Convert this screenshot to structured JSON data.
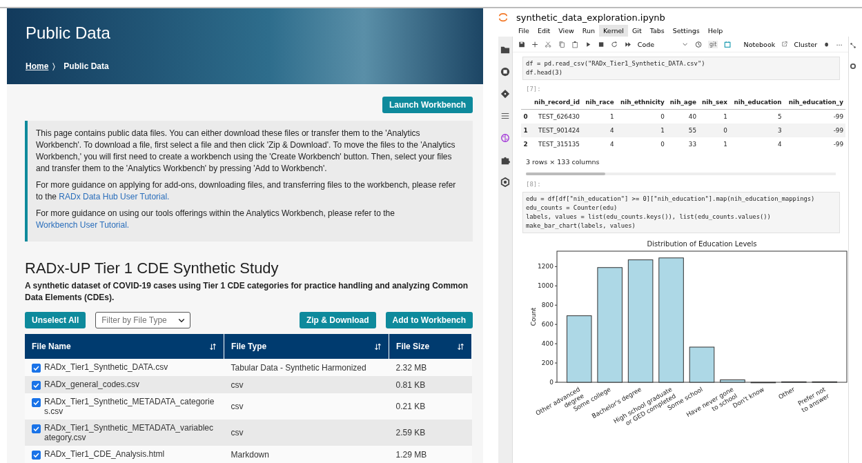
{
  "portal": {
    "title": "Public Data",
    "breadcrumb": [
      {
        "label": "Home",
        "link": true
      },
      {
        "label": "〉",
        "link": false
      },
      {
        "label": "Public Data",
        "link": false
      }
    ],
    "launch_button": "Launch Workbench",
    "info": [
      {
        "text": "This page contains public data files. You can either download these files or transfer them to the 'Analytics Workbench'. To download a file, first select a file and then click 'Zip & Download'. To move the files to the 'Analytics Workbench,' you will first need to create a workbench using the 'Create Workbench' button. Then, select your files and transfer them to the 'Analytics Workbench' by pressing 'Add to Workbench'."
      },
      {
        "text": "For more guidance on applying for add-ons, downloading files, and transferring files to the workbench, please refer to the ",
        "link": "RADx Data Hub User Tutorial."
      },
      {
        "text": "For more guidance on using our tools offerings within the Analytics Workbench, please refer to the ",
        "link": "Workbench User Tutorial."
      }
    ],
    "study_title": "RADx-UP Tier 1 CDE Synthetic Study",
    "study_description": "A synthetic dataset of COVID-19 cases using Tier 1 CDE categories for practice handling and analyzing Common Data Elements (CDEs).",
    "unselect_button": "Unselect All",
    "filter": {
      "placeholder": "Filter by File Type"
    },
    "zip_button": "Zip & Download",
    "add_button": "Add to Workbench",
    "table": {
      "columns": [
        "File Name",
        "File Type",
        "File Size"
      ],
      "rows": [
        {
          "checked": true,
          "name": "RADx_Tier1_Synthetic_DATA.csv",
          "type": "Tabular Data - Synthetic Harmonized",
          "size": "2.32 MB"
        },
        {
          "checked": true,
          "name": "RADx_general_codes.csv",
          "type": "csv",
          "size": "0.81 KB"
        },
        {
          "checked": true,
          "name": "RADx_Tier1_Synthetic_METADATA_categories.csv",
          "type": "csv",
          "size": "0.21 KB"
        },
        {
          "checked": true,
          "name": "RADx_Tier1_Synthetic_METADATA_variablecategory.csv",
          "type": "csv",
          "size": "2.59 KB"
        },
        {
          "checked": true,
          "name": "RADx_Tier1_CDE_Analysis.html",
          "type": "Markdown",
          "size": "1.29 MB"
        }
      ]
    }
  },
  "notebook": {
    "title": "synthetic_data_exploration.ipynb",
    "menu": [
      {
        "label": "File",
        "selected": false
      },
      {
        "label": "Edit",
        "selected": false
      },
      {
        "label": "View",
        "selected": false
      },
      {
        "label": "Run",
        "selected": false
      },
      {
        "label": "Kernel",
        "selected": true
      },
      {
        "label": "Git",
        "selected": false
      },
      {
        "label": "Tabs",
        "selected": false
      },
      {
        "label": "Settings",
        "selected": false
      },
      {
        "label": "Help",
        "selected": false
      }
    ],
    "cell_type": "Code",
    "git_label": "git",
    "notebook_button": "Notebook",
    "cluster_button": "Cluster",
    "more": "⋯",
    "cell1_code": [
      "df = pd.read_csv(\"RADx_Tier1_Synthetic_DATA.csv\")",
      "df.head(3)"
    ],
    "out1_prompt": "[7]:",
    "dataframe": {
      "columns": [
        "",
        "nih_record_id",
        "nih_race",
        "nih_ethnicity",
        "nih_age",
        "nih_sex",
        "nih_education",
        "nih_education_y"
      ],
      "rows": [
        [
          "0",
          "TEST_626430",
          "1",
          "0",
          "40",
          "1",
          "5",
          "-99"
        ],
        [
          "1",
          "TEST_901424",
          "4",
          "1",
          "55",
          "0",
          "3",
          "-99"
        ],
        [
          "2",
          "TEST_315135",
          "4",
          "0",
          "33",
          "1",
          "4",
          "-99"
        ]
      ],
      "summary": "3 rows × 133 columns"
    },
    "cell2_prompt": "[8]:",
    "cell2_code": [
      "edu = df[df[\"nih_education\"] >= 0][\"nih_education\"].map(nih_education_mappings)",
      "edu_counts = Counter(edu)",
      "labels, values = list(edu_counts.keys()), list(edu_counts.values())",
      "make_bar_chart(labels, values)"
    ],
    "chart_data": {
      "type": "bar",
      "title": "Distribution of Education Levels",
      "ylabel": "Count",
      "categories": [
        "Other advanced\ndegree",
        "Some college",
        "Bachelor's degree",
        "High school graduate\nor GED completed",
        "Some school",
        "Have never gone\nto school",
        "Don't know",
        "Other",
        "Prefer not\nto answer"
      ],
      "series": [
        {
          "color": "#add8e6",
          "values": [
            690,
            1190,
            1270,
            1290,
            365,
            25,
            0,
            5,
            5
          ]
        }
      ],
      "ylim": [
        0,
        1360
      ],
      "yticks": [
        0,
        200,
        400,
        600,
        800,
        1000,
        1200
      ]
    }
  }
}
